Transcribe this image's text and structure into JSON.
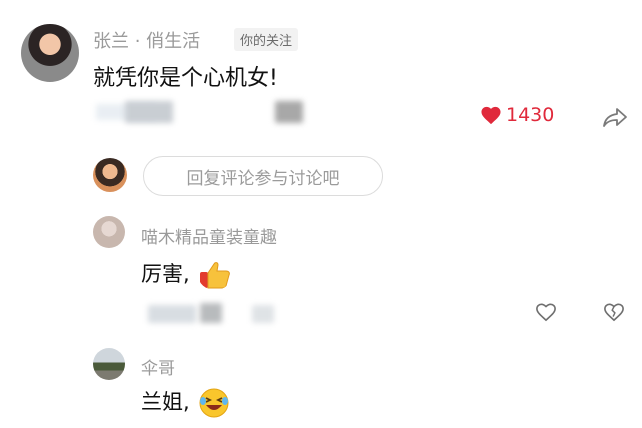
{
  "comment": {
    "username": "张兰 · 俏生活",
    "tag": "你的关注",
    "text": "就凭你是个心机女!",
    "like_count": "1430"
  },
  "reply_prompt": {
    "placeholder": "回复评论参与讨论吧"
  },
  "replies": [
    {
      "username": "喵木精品童装童趣",
      "text": "厉害,",
      "emoji": "thumbs-up-icon"
    },
    {
      "username": "伞哥",
      "text": "兰姐,",
      "emoji": "laughing-crying-icon"
    }
  ],
  "colors": {
    "like": "#e0293b",
    "muted_text": "#9a9a9a",
    "body_text": "#111111"
  }
}
